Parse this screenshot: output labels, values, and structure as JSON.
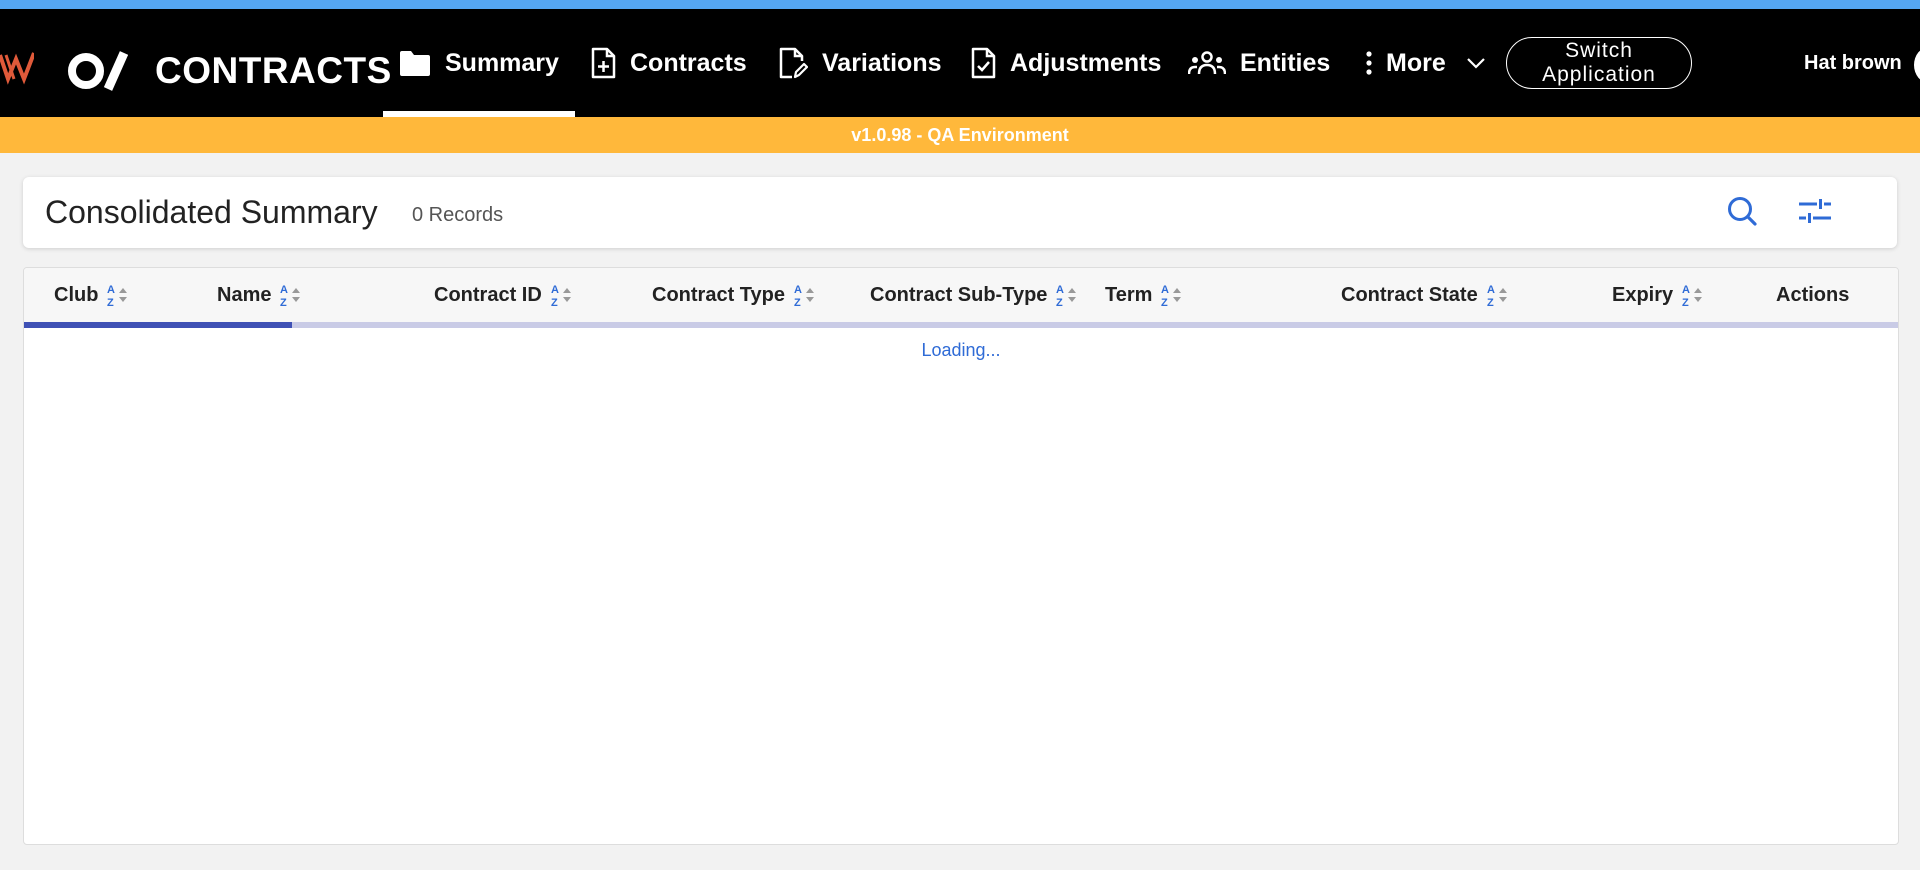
{
  "app": {
    "title": "CONTRACTS",
    "brand_color": "#e05a3a",
    "nav_color": "#000000",
    "accent_color": "#2f6bd6",
    "env_color": "#ffb83b",
    "top_strip_color": "#55a6f2"
  },
  "nav": {
    "items": [
      {
        "label": "Summary",
        "icon": "folder-icon",
        "active": true
      },
      {
        "label": "Contracts",
        "icon": "file-plus-icon"
      },
      {
        "label": "Variations",
        "icon": "file-edit-icon"
      },
      {
        "label": "Adjustments",
        "icon": "file-check-icon"
      },
      {
        "label": "Entities",
        "icon": "group-icon"
      },
      {
        "label": "More",
        "icon": "more-vertical-icon"
      }
    ],
    "switch_label": "Switch Application",
    "user_name": "Hat brown"
  },
  "env": {
    "label": "v1.0.98 - QA Environment"
  },
  "summary": {
    "title": "Consolidated Summary",
    "record_count": "0 Records"
  },
  "table": {
    "columns": [
      {
        "label": "Club",
        "sortable": true
      },
      {
        "label": "Name",
        "sortable": true
      },
      {
        "label": "Contract ID",
        "sortable": true
      },
      {
        "label": "Contract Type",
        "sortable": true
      },
      {
        "label": "Contract Sub-Type",
        "sortable": true
      },
      {
        "label": "Term",
        "sortable": true
      },
      {
        "label": "Contract State",
        "sortable": true
      },
      {
        "label": "Expiry",
        "sortable": true
      },
      {
        "label": "Actions",
        "sortable": false
      }
    ],
    "loading_text": "Loading...",
    "progress": 0.143
  }
}
